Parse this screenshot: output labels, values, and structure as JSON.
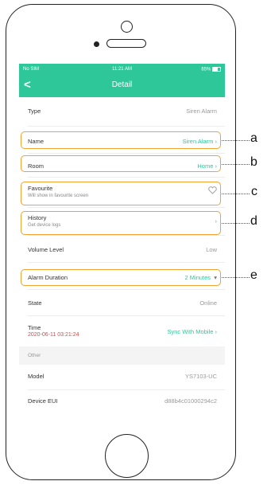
{
  "status": {
    "carrier": "No SIM",
    "time": "11:21 AM",
    "battery": "65%"
  },
  "nav": {
    "back": "<",
    "title": "Detail"
  },
  "rows": {
    "type": {
      "label": "Type",
      "value": "Siren Alarm"
    },
    "name": {
      "label": "Name",
      "value": "Siren Alarm"
    },
    "room": {
      "label": "Room",
      "value": "Home"
    },
    "favourite": {
      "label": "Favourite",
      "sub": "Will show in favourite screen"
    },
    "history": {
      "label": "History",
      "sub": "Get device logs"
    },
    "volume": {
      "label": "Volume Level",
      "value": "Low"
    },
    "alarm": {
      "label": "Alarm Duration",
      "value": "2 Minutes"
    },
    "state": {
      "label": "State",
      "value": "Online"
    },
    "time": {
      "label": "Time",
      "value": "2020-06-11 03:21:24",
      "action": "Sync With Mobile"
    },
    "model": {
      "label": "Model",
      "value": "YS7103-UC"
    },
    "eui": {
      "label": "Device EUI",
      "value": "d88b4c01000294c2"
    }
  },
  "section_other": "Other",
  "callouts": [
    "a",
    "b",
    "c",
    "d",
    "e"
  ],
  "colors": {
    "accent": "#2dc79a",
    "highlight": "#f0a233",
    "time_red": "#e04545"
  },
  "icons": {
    "back": "chevron-left-icon",
    "arrow": "chevron-right-icon",
    "favourite": "heart-icon",
    "dropdown": "caret-down-icon"
  }
}
